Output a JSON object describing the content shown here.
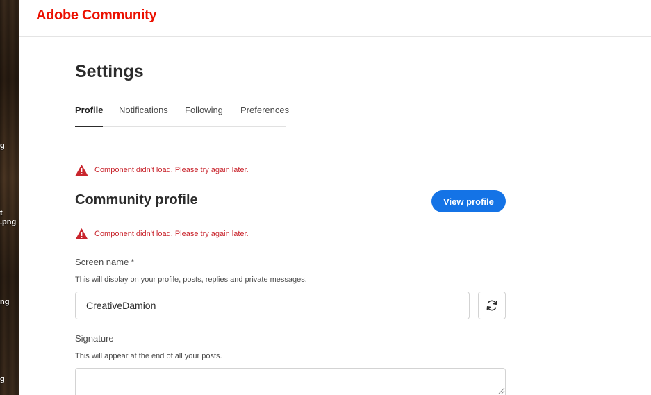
{
  "desktop": {
    "labels": [
      "g",
      "t\n.png",
      "ng",
      "g"
    ]
  },
  "header": {
    "brand": "Adobe Community",
    "brand_color": "#eb1000"
  },
  "settings": {
    "title": "Settings",
    "tabs": [
      {
        "label": "Profile",
        "active": true
      },
      {
        "label": "Notifications",
        "active": false
      },
      {
        "label": "Following",
        "active": false
      },
      {
        "label": "Preferences",
        "active": false
      }
    ]
  },
  "errors": {
    "component_error_1": "Component didn't load. Please try again later.",
    "component_error_2": "Component didn't load. Please try again later.",
    "icon": "warning-icon",
    "color": "#c9252d"
  },
  "community_profile": {
    "title": "Community profile",
    "view_profile_label": "View profile",
    "accent": "#1473e6"
  },
  "screen_name": {
    "label": "Screen name",
    "required_mark": "*",
    "help": "This will display on your profile, posts, replies and private messages.",
    "value": "CreativeDamion",
    "refresh_icon": "refresh-icon"
  },
  "signature": {
    "label": "Signature",
    "help": "This will appear at the end of all your posts.",
    "value": ""
  }
}
